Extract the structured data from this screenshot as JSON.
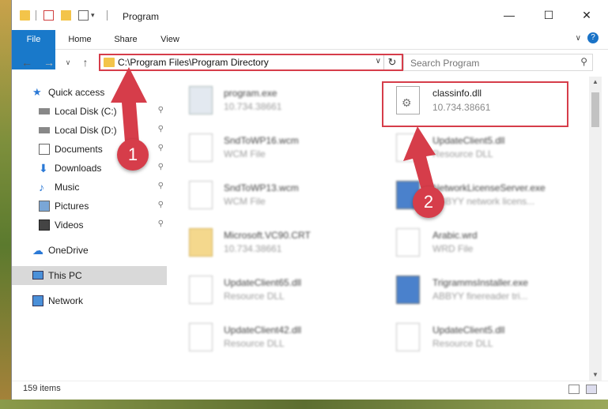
{
  "window": {
    "title": "Program",
    "minimize_glyph": "—",
    "maximize_glyph": "☐",
    "close_glyph": "✕"
  },
  "ribbon": {
    "tabs": [
      {
        "label": "File"
      },
      {
        "label": "Home"
      },
      {
        "label": "Share"
      },
      {
        "label": "View"
      }
    ],
    "help_glyph": "?",
    "collapse_glyph": "∨"
  },
  "address_bar": {
    "path": "C:\\Program Files\\Program Directory",
    "dropdown_glyph": "∨",
    "refresh_glyph": "↻"
  },
  "search": {
    "placeholder": "Search Program",
    "icon_glyph": "⚲"
  },
  "nav": {
    "back": "←",
    "forward": "→",
    "recent": "∨",
    "up": "↑",
    "items": [
      {
        "label": "Quick access",
        "icon": "star-icon",
        "pinned": false
      },
      {
        "label": "Local Disk (C:)",
        "icon": "drive-icon",
        "pinned": true
      },
      {
        "label": "Local Disk (D:)",
        "icon": "drive-icon",
        "pinned": true
      },
      {
        "label": "Documents",
        "icon": "documents-icon",
        "pinned": true
      },
      {
        "label": "Downloads",
        "icon": "downloads-icon",
        "pinned": true
      },
      {
        "label": "Music",
        "icon": "music-icon",
        "pinned": true
      },
      {
        "label": "Pictures",
        "icon": "pictures-icon",
        "pinned": true
      },
      {
        "label": "Videos",
        "icon": "videos-icon",
        "pinned": true
      },
      {
        "label": "OneDrive",
        "icon": "onedrive-icon",
        "pinned": false
      },
      {
        "label": "This PC",
        "icon": "pc-icon",
        "pinned": false
      },
      {
        "label": "Network",
        "icon": "network-icon",
        "pinned": false
      }
    ],
    "pin_glyph": "📌"
  },
  "files": [
    {
      "name": "program.exe",
      "sub": "10.734.38661",
      "icon": "exe-icon"
    },
    {
      "name": "classinfo.dll",
      "sub": "10.734.38661",
      "icon": "dll-icon"
    },
    {
      "name": "SndToWP16.wcm",
      "sub": "WCM File",
      "icon": "file-icon"
    },
    {
      "name": "UpdateClient5.dll",
      "sub": "Resource DLL",
      "icon": "dll-icon"
    },
    {
      "name": "SndToWP13.wcm",
      "sub": "WCM File",
      "icon": "file-icon"
    },
    {
      "name": "NetworkLicenseServer.exe",
      "sub": "ABBYY network licens...",
      "icon": "app-icon"
    },
    {
      "name": "Microsoft.VC90.CRT",
      "sub": "10.734.38661",
      "icon": "folder-icon"
    },
    {
      "name": "Arabic.wrd",
      "sub": "WRD File",
      "icon": "file-icon"
    },
    {
      "name": "UpdateClient65.dll",
      "sub": "Resource DLL",
      "icon": "dll-icon"
    },
    {
      "name": "TrigrammsInstaller.exe",
      "sub": "ABBYY finereader tri...",
      "icon": "app-icon"
    },
    {
      "name": "UpdateClient42.dll",
      "sub": "Resource DLL",
      "icon": "dll-icon"
    },
    {
      "name": "UpdateClient5.dll",
      "sub": "Resource DLL",
      "icon": "dll-icon"
    }
  ],
  "status": {
    "item_count": "159 items"
  },
  "annotations": {
    "marker1": "1",
    "marker2": "2",
    "color": "#d63d4a"
  }
}
